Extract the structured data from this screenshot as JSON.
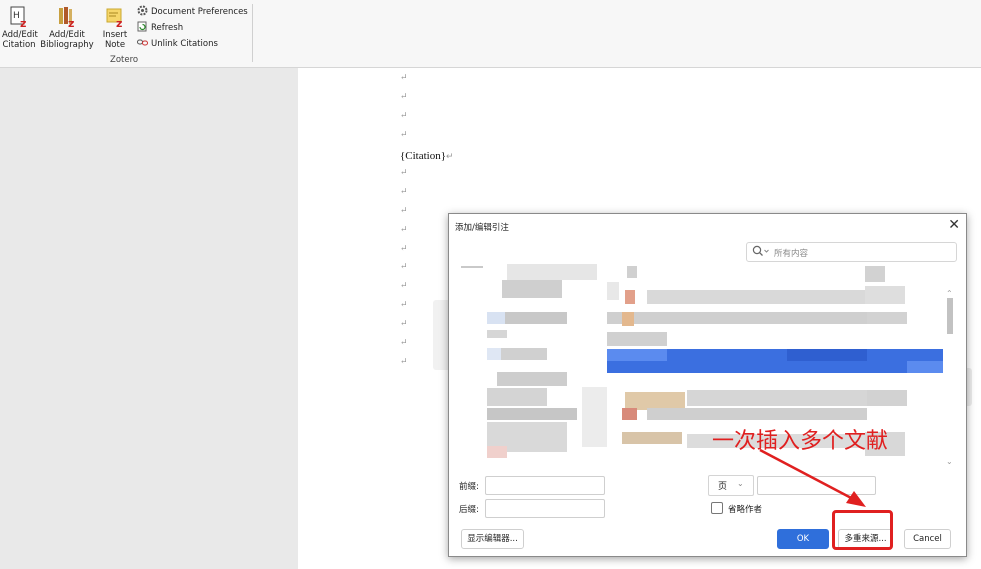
{
  "ribbon": {
    "add_edit_citation": "Add/Edit\nCitation",
    "add_edit_bibliography": "Add/Edit\nBibliography",
    "insert_note": "Insert\nNote",
    "document_preferences": "Document Preferences",
    "refresh": "Refresh",
    "unlink_citations": "Unlink Citations",
    "group_label": "Zotero"
  },
  "document": {
    "paragraph_mark": "↵",
    "citation_text": "{Citation}"
  },
  "dialog": {
    "title": "添加/编辑引注",
    "close": "✕",
    "search_placeholder": "所有内容",
    "prefix_label": "前缀:",
    "suffix_label": "后缀:",
    "locator_value": "页",
    "omit_author_label": "省略作者",
    "show_editor_button": "显示编辑器...",
    "ok_button": "OK",
    "multiple_sources_button": "多重来源...",
    "cancel_button": "Cancel",
    "selected_row_color": "#3b6fe0"
  },
  "annotation": {
    "text": "一次插入多个文献",
    "color": "#e02020"
  }
}
